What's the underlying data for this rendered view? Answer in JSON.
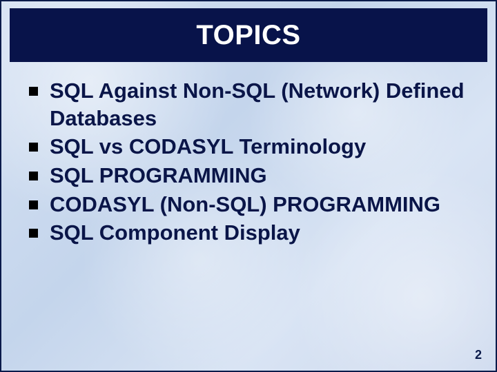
{
  "title": "TOPICS",
  "bullets": [
    "SQL Against Non-SQL (Network) Defined Databases",
    "SQL vs CODASYL Terminology",
    "SQL PROGRAMMING",
    "CODASYL (Non-SQL) PROGRAMMING",
    "SQL Component Display"
  ],
  "page_number": "2"
}
